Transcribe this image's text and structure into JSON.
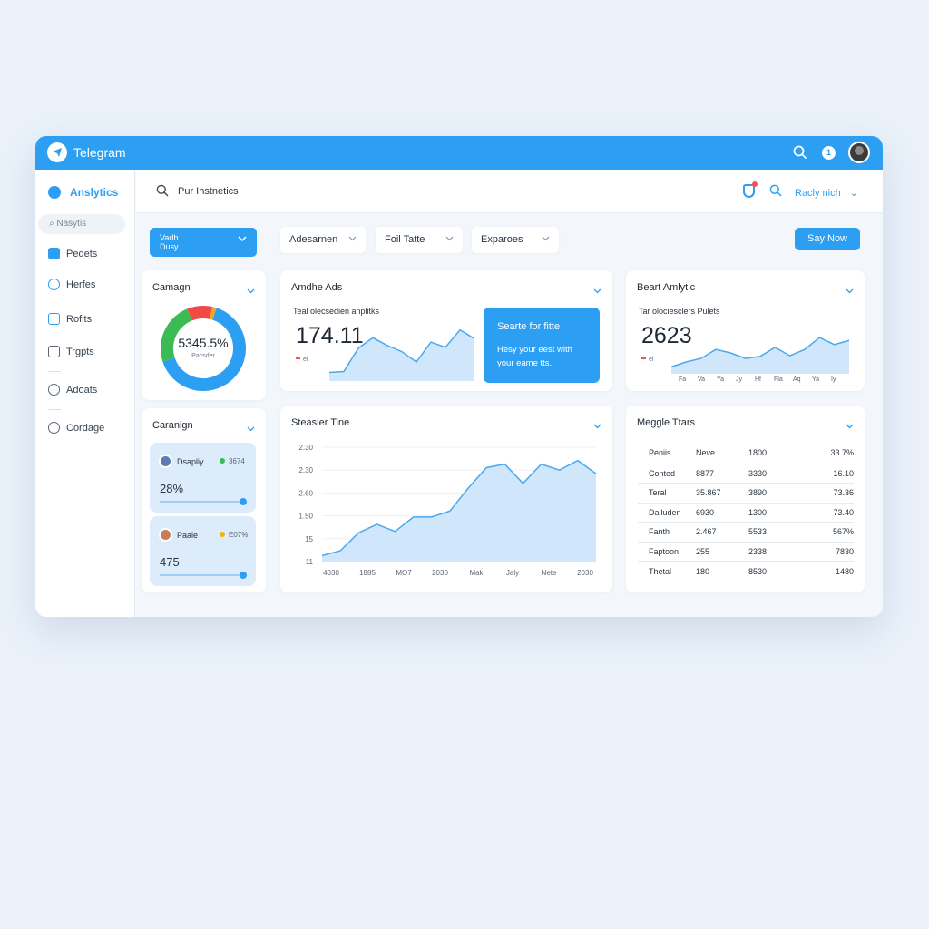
{
  "titlebar": {
    "app_name": "Telegram",
    "notification_count": "1"
  },
  "sidebar": {
    "app_label": "Anslytics",
    "search_placeholder": "Nasytis",
    "items": [
      {
        "label": "Pedets",
        "icon": "document-icon"
      },
      {
        "label": "Herfes",
        "icon": "target-icon"
      },
      {
        "label": "Rofits",
        "icon": "hand-icon"
      },
      {
        "label": "Trgpts",
        "icon": "inbox-icon"
      },
      {
        "label": "Adoats",
        "icon": "timer-icon"
      },
      {
        "label": "Cordage",
        "icon": "globe-icon"
      }
    ]
  },
  "topbar": {
    "search_text": "Pur Ihstnetics",
    "dropdown_label": "Racly nich"
  },
  "filters": {
    "primary": {
      "line1": "Vadh",
      "line2": "Dusy"
    },
    "items": [
      "Adesarnen",
      "Foil Tatte",
      "Exparoes"
    ]
  },
  "cta_label": "Say Now",
  "campaign_card": {
    "title": "Camagn",
    "center_value": "5345.5%",
    "center_sub": "Pacsder"
  },
  "campaign_card2": {
    "title": "Caranign",
    "rows": [
      {
        "name": "Dsapliy",
        "stat": "3674",
        "value": "28%",
        "dot_color": "#3cba54"
      },
      {
        "name": "Paale",
        "stat": "E07%",
        "value": "475",
        "dot_color": "#f4b400"
      }
    ]
  },
  "ads_card": {
    "title": "Amdhe Ads",
    "subtitle": "Teal olecsedien anplitks",
    "value": "174.11",
    "tiny": "el"
  },
  "promo": {
    "title": "Searte for fitte",
    "body_line1": "Hesy your eest with",
    "body_line2": "your eame tts."
  },
  "beart_card": {
    "title": "Beart Amlytic",
    "subtitle": "Tar olociesclers Pulets",
    "value": "2623",
    "tiny": "el",
    "x_labels": [
      "Fa",
      "Va",
      "Ya",
      "Jy",
      "Hf",
      "Fla",
      "Aq",
      "Ya",
      "Iy"
    ]
  },
  "time_card": {
    "title": "Steasler Tine"
  },
  "table_card": {
    "title": "Meggle Ttars",
    "header": [
      "Peniis",
      "Neve",
      "1800",
      "33.7%"
    ],
    "rows": [
      [
        "Conted",
        "8877",
        "3330",
        "16.10"
      ],
      [
        "Teral",
        "35.867",
        "3890",
        "73.36"
      ],
      [
        "Dalluden",
        "6930",
        "1300",
        "73.40"
      ],
      [
        "Fanth",
        "2.467",
        "5533",
        "567%"
      ],
      [
        "Faptoon",
        "255",
        "2338",
        "7830"
      ],
      [
        "Thetal",
        "180",
        "8530",
        "1480"
      ]
    ]
  },
  "chart_data": [
    {
      "type": "area",
      "title": "Steasler Tine",
      "x_labels": [
        "4030",
        "1885",
        "MO7",
        "2030",
        "Mak",
        "Jaly",
        "Nete",
        "2030"
      ],
      "y_labels": [
        "11",
        "15",
        "1.50",
        "2.60",
        "2.30",
        "2.30"
      ],
      "series": [
        {
          "x": [
            0,
            1,
            2,
            3,
            4,
            5,
            6,
            7,
            8,
            9,
            10,
            11,
            12,
            13,
            14,
            15
          ],
          "values": [
            11,
            11.4,
            12.9,
            13.6,
            13.0,
            14.2,
            14.2,
            14.7,
            16.6,
            18.3,
            18.6,
            17.0,
            18.6,
            18.1,
            18.9,
            17.8
          ]
        }
      ],
      "ylim": [
        10.5,
        20
      ]
    },
    {
      "type": "area",
      "title": "Amdhe Ads",
      "series": [
        {
          "values": [
            1,
            1.1,
            3.8,
            5.0,
            4.1,
            3.4,
            2.2,
            4.5,
            3.9,
            5.9,
            4.9
          ]
        }
      ],
      "ylim": [
        0,
        6.5
      ]
    },
    {
      "type": "area",
      "title": "Beart Amlytic",
      "series": [
        {
          "values": [
            1,
            1.7,
            2.2,
            3.5,
            3.0,
            2.2,
            2.5,
            3.8,
            2.6,
            3.5,
            5.2,
            4.2,
            4.8
          ]
        }
      ],
      "ylim": [
        0,
        6
      ]
    }
  ],
  "colors": {
    "accent": "#2c9ff2",
    "donut": [
      "#2c9ff2",
      "#3cba54",
      "#ef4a43",
      "#f5a623"
    ]
  }
}
